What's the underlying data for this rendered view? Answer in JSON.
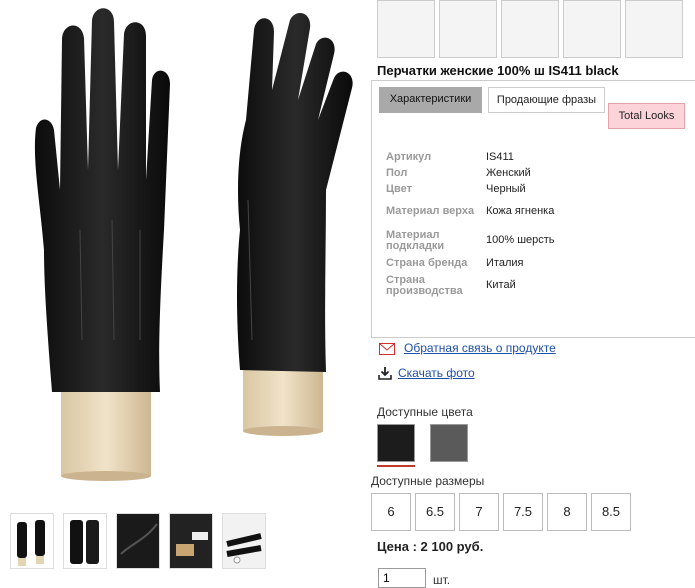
{
  "product": {
    "title": "Перчатки женские 100% ш IS411 black",
    "price": "Цена : 2 100 руб."
  },
  "tabs": [
    {
      "label": "Характеристики",
      "active": true
    },
    {
      "label": "Продающие фразы",
      "active": false
    },
    {
      "label": "Total Looks",
      "active": false
    }
  ],
  "specs": [
    {
      "key": "Артикул",
      "value": "IS411"
    },
    {
      "key": "Пол",
      "value": "Женский"
    },
    {
      "key": "Цвет",
      "value": "Черный"
    },
    {
      "key": "Материал верха",
      "value": "Кожа ягненка"
    },
    {
      "key": "Материал подкладки",
      "value": "100% шерсть"
    },
    {
      "key": "Страна бренда",
      "value": "Италия"
    },
    {
      "key": "Страна производства",
      "value": "Китай"
    }
  ],
  "links": {
    "feedback": "Обратная связь о продукте",
    "download": "Скачать фото"
  },
  "colors": {
    "label": "Доступные цвета",
    "swatches": [
      "#1c1c1c",
      "#5a5a5a"
    ],
    "selected_underline": "#c0392b"
  },
  "sizes": {
    "label": "Доступные размеры",
    "values": [
      "6",
      "6.5",
      "7",
      "7.5",
      "8",
      "8.5"
    ]
  },
  "quantity": {
    "value": "1",
    "unit": "шт."
  },
  "icons": {
    "feedback": "envelope-icon",
    "download": "download-icon"
  },
  "thumbnail_count": 5
}
